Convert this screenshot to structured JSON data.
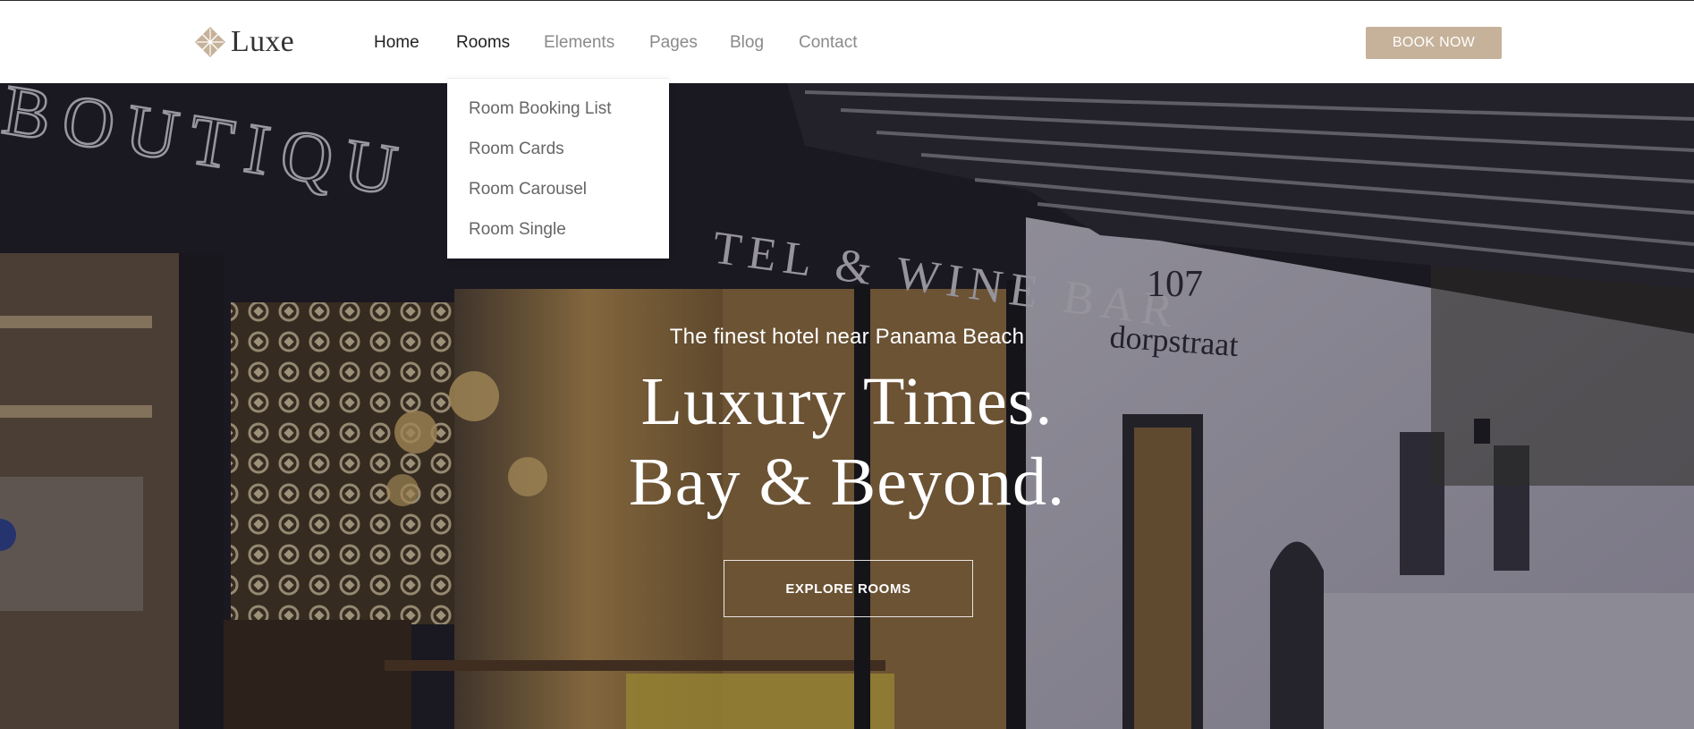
{
  "brand": {
    "name": "Luxe",
    "accent_color": "#c6b29a"
  },
  "nav": {
    "items": [
      {
        "label": "Home"
      },
      {
        "label": "Rooms"
      },
      {
        "label": "Elements"
      },
      {
        "label": "Pages"
      },
      {
        "label": "Blog"
      },
      {
        "label": "Contact"
      }
    ],
    "book_now_label": "BOOK NOW"
  },
  "rooms_dropdown": {
    "items": [
      {
        "label": "Room Booking List"
      },
      {
        "label": "Room Cards"
      },
      {
        "label": "Room Carousel"
      },
      {
        "label": "Room Single"
      }
    ]
  },
  "hero": {
    "subtitle": "The finest hotel near Panama Beach",
    "title_line1": "Luxury Times.",
    "title_line2": "Bay & Beyond.",
    "cta_label": "EXPLORE ROOMS",
    "background_image": {
      "icon": "hotel-storefront-photo",
      "sign_text_1": "BOUTIQU",
      "sign_text_2": "TEL & WINE BAR",
      "address_number": "107",
      "address_street": "dorpstraat"
    }
  }
}
